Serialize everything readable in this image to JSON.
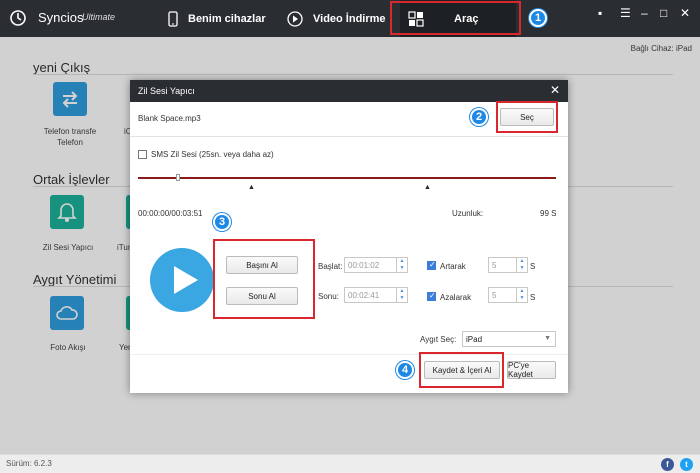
{
  "app": {
    "name": "Syncios",
    "edition": "Ultimate"
  },
  "nav": [
    {
      "label": "Benim cihazlar",
      "icon": "phone-icon"
    },
    {
      "label": "Video İndirme",
      "icon": "play-circle-icon"
    },
    {
      "label": "Araç",
      "icon": "grid-icon"
    }
  ],
  "callouts": [
    "1",
    "2",
    "3",
    "4"
  ],
  "connected_device": "Bağlı Cihaz: iPad",
  "sections": {
    "new": {
      "title": "yeni Çıkış",
      "tiles": [
        "Telefon transfe Telefon",
        "iO"
      ]
    },
    "common": {
      "title": "Ortak İşlevler",
      "tiles": [
        "Zil Sesi Yapıcı",
        "iTun"
      ]
    },
    "device": {
      "title": "Aygıt Yönetimi",
      "tiles": [
        "Foto Akışı",
        "Yer"
      ]
    }
  },
  "dialog": {
    "title": "Zil Sesi Yapıcı",
    "file_name": "Blank Space.mp3",
    "select_button": "Seç",
    "sms_label": "SMS Zil Sesi (25sn. veya daha az)",
    "time_readout": "00:00:00/00:03:51",
    "length_label": "Uzunluk:",
    "length_value": "99 S",
    "set_start_button": "Başını Al",
    "set_end_button": "Sonu Al",
    "start_label": "Başlat:",
    "start_value": "00:01:02",
    "end_label": "Sonu:",
    "end_value": "00:02:41",
    "fade_in_label": "Artarak",
    "fade_in_value": "5",
    "fade_out_label": "Azalarak",
    "fade_out_value": "5",
    "seconds_unit": "S",
    "device_select_label": "Aygıt Seç:",
    "device_select_value": "iPad",
    "save_import_button": "Kaydet & İçeri Al",
    "save_pc_button": "PC'ye Kaydet"
  },
  "footer": {
    "version": "Sürüm: 6.2.3"
  },
  "colors": {
    "accent": "#1e88e5",
    "callout": "#d9272e",
    "tile_blue": "#2f9ee0",
    "tile_teal": "#1bb39b",
    "topbar": "#2a2e33"
  }
}
